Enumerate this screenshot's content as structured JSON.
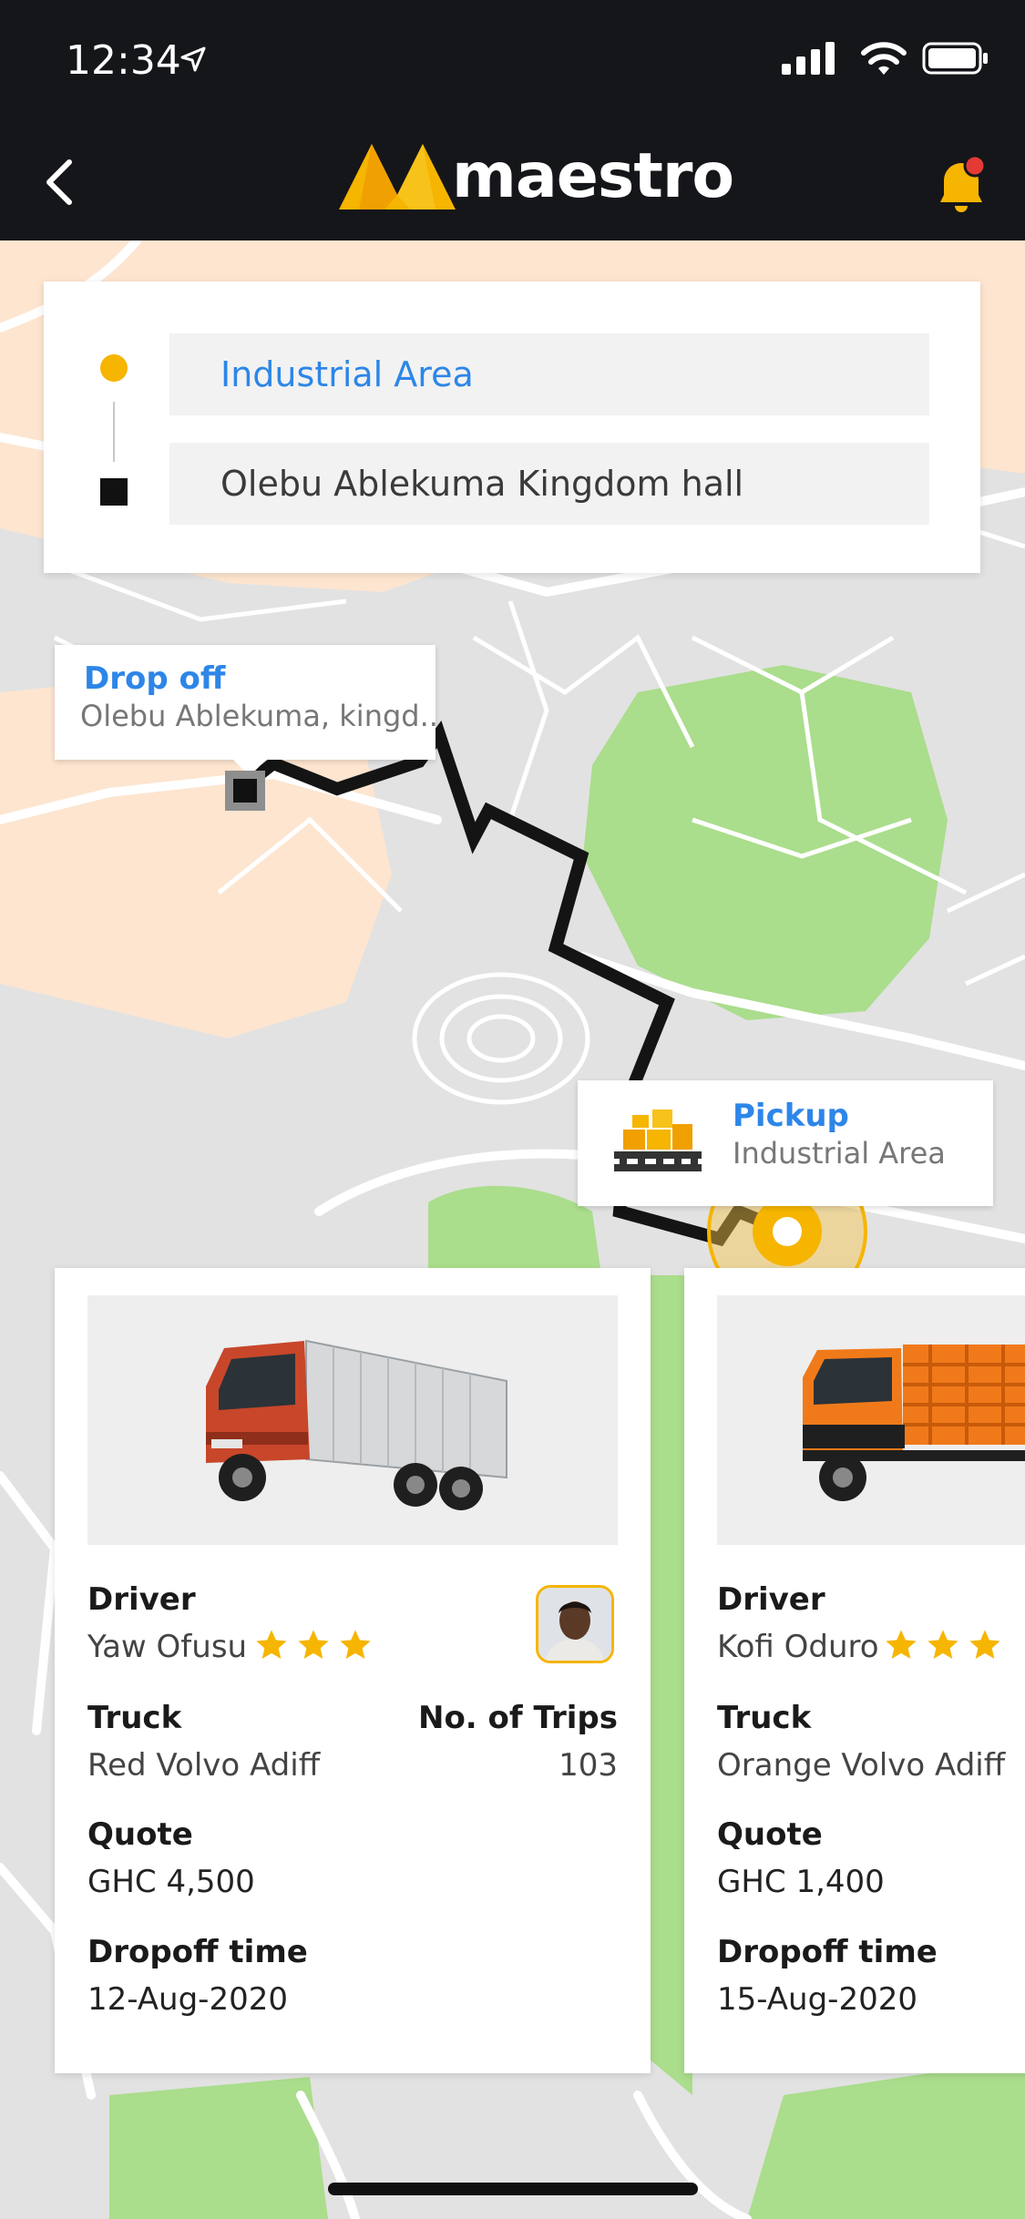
{
  "status_bar": {
    "time": "12:34",
    "icons": [
      "location-arrow-icon",
      "cellular-signal-icon",
      "wifi-icon",
      "battery-icon"
    ]
  },
  "header": {
    "brand": "maestro",
    "back_icon": "chevron-left-icon",
    "notification_icon": "bell-icon",
    "has_notification_badge": true
  },
  "route": {
    "pickup_value": "Industrial Area",
    "dropoff_value": "Olebu Ablekuma Kingdom hall"
  },
  "map": {
    "dropoff_callout": {
      "title": "Drop off",
      "subtitle": "Olebu Ablekuma, kingd.."
    },
    "pickup_callout": {
      "title": "Pickup",
      "subtitle": "Industrial Area"
    }
  },
  "trucks": [
    {
      "driver_label": "Driver",
      "driver_name": "Yaw Ofusu",
      "rating": 3,
      "truck_label": "Truck",
      "truck_name": "Red Volvo Adiff",
      "trips_label": "No. of Trips",
      "trips": "103",
      "quote_label": "Quote",
      "quote": "GHC 4,500",
      "dropoff_label": "Dropoff time",
      "dropoff_time": "12-Aug-2020",
      "truck_color": "#c8462a"
    },
    {
      "driver_label": "Driver",
      "driver_name": "Kofi Oduro",
      "rating": 3,
      "truck_label": "Truck",
      "truck_name": "Orange Volvo Adiff",
      "quote_label": "Quote",
      "quote": "GHC 1,400",
      "dropoff_label": "Dropoff time",
      "dropoff_time": "15-Aug-2020",
      "truck_color": "#f07a1a"
    }
  ],
  "colors": {
    "accent_yellow": "#f6b500",
    "link_blue": "#2d86e8",
    "topbar_bg": "#15161a",
    "map_park_green": "#a8dc8a",
    "map_area_peach": "#fde3cc"
  }
}
